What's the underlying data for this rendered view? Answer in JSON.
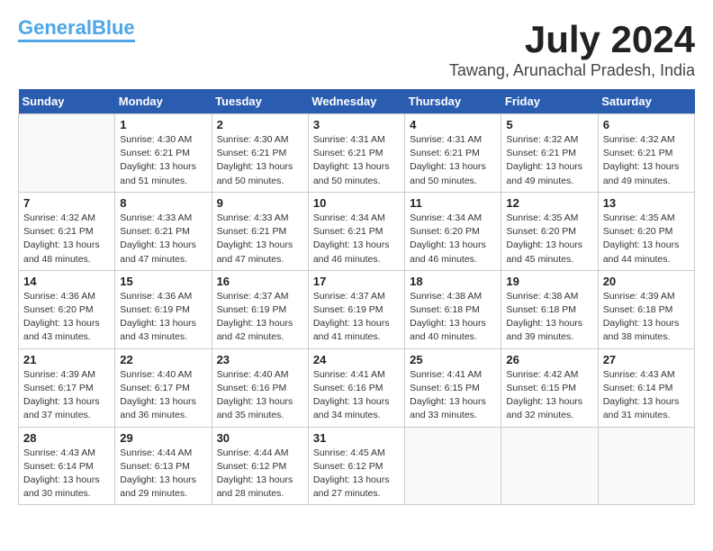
{
  "header": {
    "logo_line1": "General",
    "logo_line1_accent": "Blue",
    "month": "July 2024",
    "location": "Tawang, Arunachal Pradesh, India"
  },
  "weekdays": [
    "Sunday",
    "Monday",
    "Tuesday",
    "Wednesday",
    "Thursday",
    "Friday",
    "Saturday"
  ],
  "weeks": [
    [
      {
        "day": "",
        "info": ""
      },
      {
        "day": "1",
        "info": "Sunrise: 4:30 AM\nSunset: 6:21 PM\nDaylight: 13 hours\nand 51 minutes."
      },
      {
        "day": "2",
        "info": "Sunrise: 4:30 AM\nSunset: 6:21 PM\nDaylight: 13 hours\nand 50 minutes."
      },
      {
        "day": "3",
        "info": "Sunrise: 4:31 AM\nSunset: 6:21 PM\nDaylight: 13 hours\nand 50 minutes."
      },
      {
        "day": "4",
        "info": "Sunrise: 4:31 AM\nSunset: 6:21 PM\nDaylight: 13 hours\nand 50 minutes."
      },
      {
        "day": "5",
        "info": "Sunrise: 4:32 AM\nSunset: 6:21 PM\nDaylight: 13 hours\nand 49 minutes."
      },
      {
        "day": "6",
        "info": "Sunrise: 4:32 AM\nSunset: 6:21 PM\nDaylight: 13 hours\nand 49 minutes."
      }
    ],
    [
      {
        "day": "7",
        "info": "Sunrise: 4:32 AM\nSunset: 6:21 PM\nDaylight: 13 hours\nand 48 minutes."
      },
      {
        "day": "8",
        "info": "Sunrise: 4:33 AM\nSunset: 6:21 PM\nDaylight: 13 hours\nand 47 minutes."
      },
      {
        "day": "9",
        "info": "Sunrise: 4:33 AM\nSunset: 6:21 PM\nDaylight: 13 hours\nand 47 minutes."
      },
      {
        "day": "10",
        "info": "Sunrise: 4:34 AM\nSunset: 6:21 PM\nDaylight: 13 hours\nand 46 minutes."
      },
      {
        "day": "11",
        "info": "Sunrise: 4:34 AM\nSunset: 6:20 PM\nDaylight: 13 hours\nand 46 minutes."
      },
      {
        "day": "12",
        "info": "Sunrise: 4:35 AM\nSunset: 6:20 PM\nDaylight: 13 hours\nand 45 minutes."
      },
      {
        "day": "13",
        "info": "Sunrise: 4:35 AM\nSunset: 6:20 PM\nDaylight: 13 hours\nand 44 minutes."
      }
    ],
    [
      {
        "day": "14",
        "info": "Sunrise: 4:36 AM\nSunset: 6:20 PM\nDaylight: 13 hours\nand 43 minutes."
      },
      {
        "day": "15",
        "info": "Sunrise: 4:36 AM\nSunset: 6:19 PM\nDaylight: 13 hours\nand 43 minutes."
      },
      {
        "day": "16",
        "info": "Sunrise: 4:37 AM\nSunset: 6:19 PM\nDaylight: 13 hours\nand 42 minutes."
      },
      {
        "day": "17",
        "info": "Sunrise: 4:37 AM\nSunset: 6:19 PM\nDaylight: 13 hours\nand 41 minutes."
      },
      {
        "day": "18",
        "info": "Sunrise: 4:38 AM\nSunset: 6:18 PM\nDaylight: 13 hours\nand 40 minutes."
      },
      {
        "day": "19",
        "info": "Sunrise: 4:38 AM\nSunset: 6:18 PM\nDaylight: 13 hours\nand 39 minutes."
      },
      {
        "day": "20",
        "info": "Sunrise: 4:39 AM\nSunset: 6:18 PM\nDaylight: 13 hours\nand 38 minutes."
      }
    ],
    [
      {
        "day": "21",
        "info": "Sunrise: 4:39 AM\nSunset: 6:17 PM\nDaylight: 13 hours\nand 37 minutes."
      },
      {
        "day": "22",
        "info": "Sunrise: 4:40 AM\nSunset: 6:17 PM\nDaylight: 13 hours\nand 36 minutes."
      },
      {
        "day": "23",
        "info": "Sunrise: 4:40 AM\nSunset: 6:16 PM\nDaylight: 13 hours\nand 35 minutes."
      },
      {
        "day": "24",
        "info": "Sunrise: 4:41 AM\nSunset: 6:16 PM\nDaylight: 13 hours\nand 34 minutes."
      },
      {
        "day": "25",
        "info": "Sunrise: 4:41 AM\nSunset: 6:15 PM\nDaylight: 13 hours\nand 33 minutes."
      },
      {
        "day": "26",
        "info": "Sunrise: 4:42 AM\nSunset: 6:15 PM\nDaylight: 13 hours\nand 32 minutes."
      },
      {
        "day": "27",
        "info": "Sunrise: 4:43 AM\nSunset: 6:14 PM\nDaylight: 13 hours\nand 31 minutes."
      }
    ],
    [
      {
        "day": "28",
        "info": "Sunrise: 4:43 AM\nSunset: 6:14 PM\nDaylight: 13 hours\nand 30 minutes."
      },
      {
        "day": "29",
        "info": "Sunrise: 4:44 AM\nSunset: 6:13 PM\nDaylight: 13 hours\nand 29 minutes."
      },
      {
        "day": "30",
        "info": "Sunrise: 4:44 AM\nSunset: 6:12 PM\nDaylight: 13 hours\nand 28 minutes."
      },
      {
        "day": "31",
        "info": "Sunrise: 4:45 AM\nSunset: 6:12 PM\nDaylight: 13 hours\nand 27 minutes."
      },
      {
        "day": "",
        "info": ""
      },
      {
        "day": "",
        "info": ""
      },
      {
        "day": "",
        "info": ""
      }
    ]
  ]
}
